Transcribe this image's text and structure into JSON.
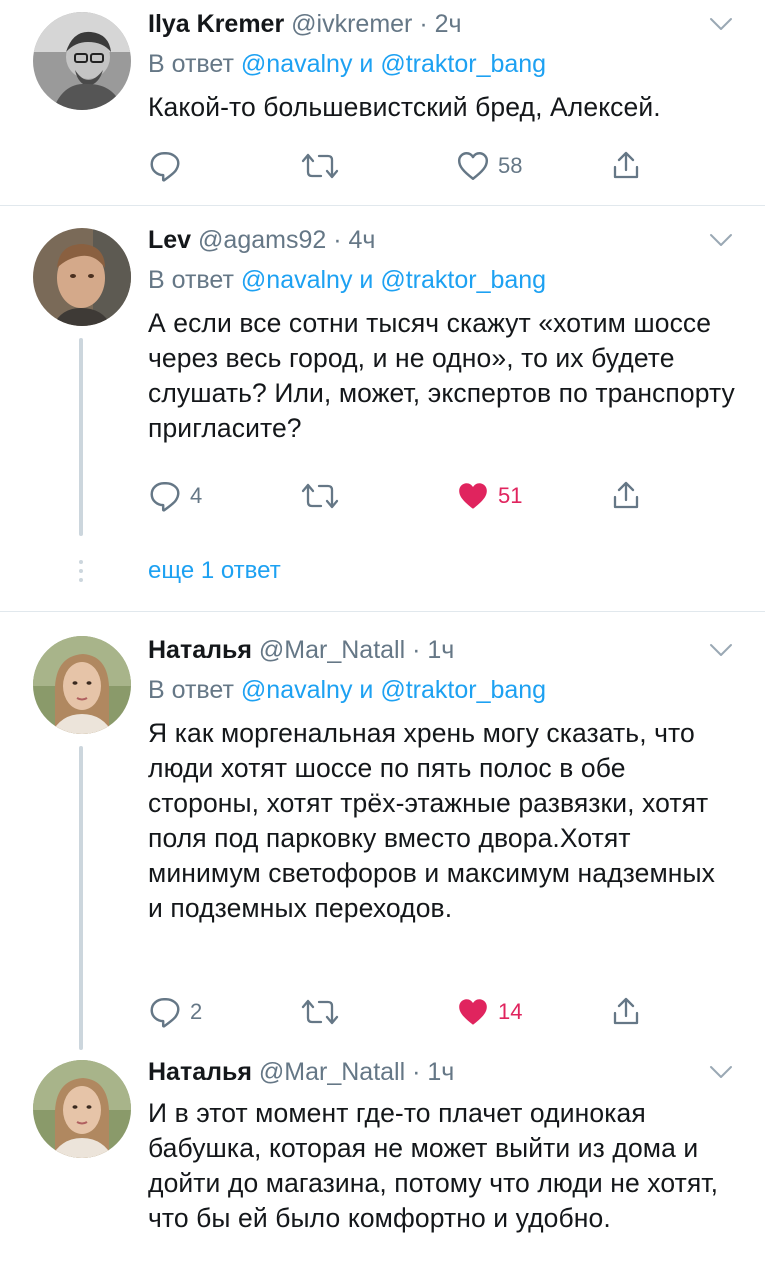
{
  "tweets": [
    {
      "name": "Ilya Kremer",
      "handle": "@ivkremer",
      "time": "2ч",
      "reply_prefix": "В ответ",
      "mention1": "@navalny",
      "and": "и",
      "mention2": "@traktor_bang",
      "text": "Какой-то большевистский бред, Алексей.",
      "replies": "",
      "likes": "58",
      "liked": false,
      "avatar_icon": "avatar-photo"
    },
    {
      "name": "Lev",
      "handle": "@agams92",
      "time": "4ч",
      "reply_prefix": "В ответ",
      "mention1": "@navalny",
      "and": "и",
      "mention2": "@traktor_bang",
      "text": "А если все сотни тысяч скажут «хотим шоссе через весь город, и не одно», то их будете слушать? Или, может, экспертов по транспорту пригласите?",
      "replies": "4",
      "likes": "51",
      "liked": true,
      "avatar_icon": "avatar-photo"
    },
    {
      "name": "Наталья",
      "handle": "@Mar_Natall",
      "time": "1ч",
      "reply_prefix": "В ответ",
      "mention1": "@navalny",
      "and": "и",
      "mention2": "@traktor_bang",
      "text": "Я как моргенальная хрень могу сказать, что люди хотят шоссе по пять полос в обе стороны, хотят трёх-этажные развязки, хотят поля под парковку вместо двора.Хотят минимум светофоров и максимум надземных и подземных переходов.",
      "replies": "2",
      "likes": "14",
      "liked": true,
      "avatar_icon": "avatar-photo"
    },
    {
      "name": "Наталья",
      "handle": "@Mar_Natall",
      "time": "1ч",
      "text": "И в этот момент где-то плачет одинокая бабушка, которая не может выйти из дома и дойти до магазина, потому что люди не хотят, что бы ей было комфортно и удобно.",
      "avatar_icon": "avatar-photo"
    }
  ],
  "more_replies": "еще 1 ответ",
  "separator": " · ",
  "colors": {
    "link": "#1da1f2",
    "muted": "#657786",
    "like": "#e0245e",
    "divider": "#e1e8ed"
  },
  "icons": [
    "reply-icon",
    "retweet-icon",
    "like-icon",
    "share-icon",
    "chevron-down-icon"
  ]
}
